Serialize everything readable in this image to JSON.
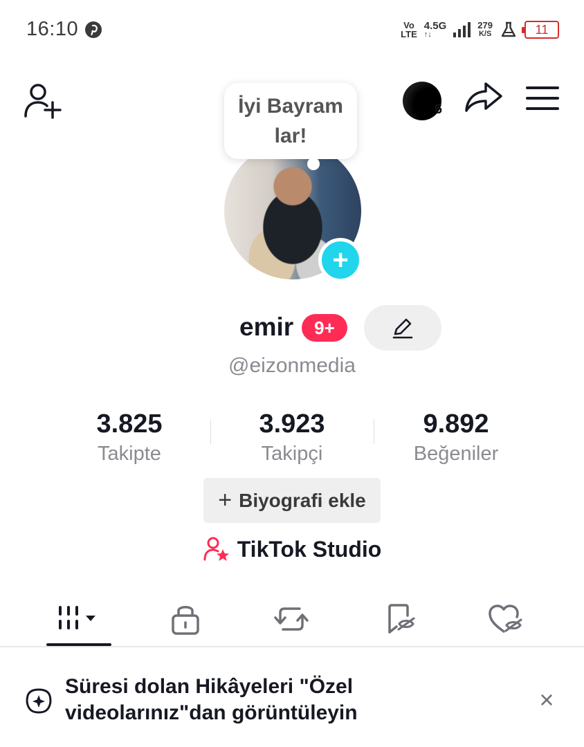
{
  "status_bar": {
    "time": "16:10",
    "pinterest_icon": "pinterest-icon",
    "volte_line1": "Vo",
    "volte_line2": "LTE",
    "network": "4.5G",
    "network_sub": "↑↓",
    "speed_value": "279",
    "speed_unit": "K/S",
    "battery_level": "11",
    "battery_color": "#d42c2c"
  },
  "header": {
    "add_friend_icon": "add-user-icon",
    "notification_count": "6",
    "share_icon": "share-arrow-icon",
    "menu_icon": "hamburger-menu-icon"
  },
  "profile": {
    "bubble_text_line1": "İyi Bayram",
    "bubble_text_line2": "lar!",
    "add_photo_symbol": "+",
    "name": "emir",
    "badge": "9+",
    "handle": "@eizonmedia",
    "accent_color": "#fe2c55",
    "add_button_color": "#20d5ec"
  },
  "stats": [
    {
      "value": "3.825",
      "label": "Takipte"
    },
    {
      "value": "3.923",
      "label": "Takipçi"
    },
    {
      "value": "9.892",
      "label": "Beğeniler"
    }
  ],
  "bio_button": {
    "plus": "+",
    "label": "Biyografi ekle"
  },
  "studio": {
    "label": "TikTok Studio",
    "icon": "user-star-icon"
  },
  "tabs": [
    {
      "name": "videos-grid",
      "icon": "grid-bars-icon",
      "active": true
    },
    {
      "name": "private",
      "icon": "lock-icon",
      "active": false
    },
    {
      "name": "reposts",
      "icon": "repost-icon",
      "active": false
    },
    {
      "name": "favorites",
      "icon": "bookmark-hidden-icon",
      "active": false
    },
    {
      "name": "liked",
      "icon": "heart-hidden-icon",
      "active": false
    }
  ],
  "notice": {
    "line1": "Süresi dolan Hikâyeleri \"Özel",
    "line2": "videolarınız\"dan görüntüleyin",
    "close": "×"
  }
}
